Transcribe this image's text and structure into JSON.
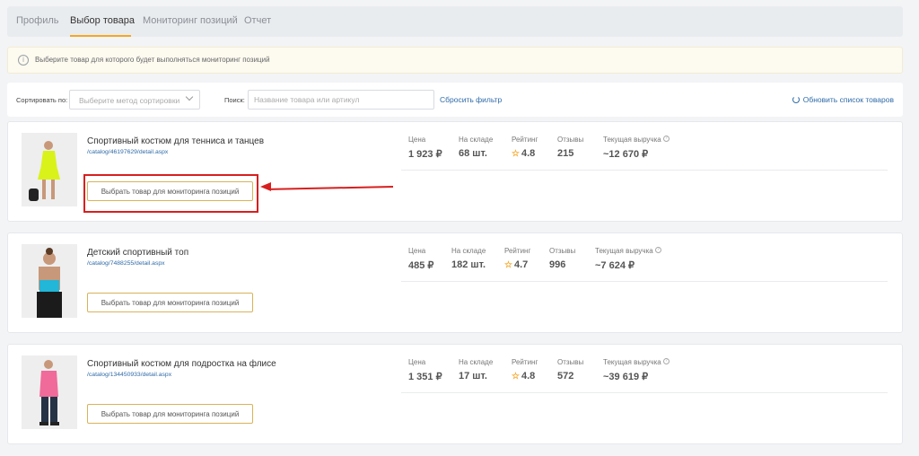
{
  "tabs": [
    {
      "label": "Профиль",
      "active": false
    },
    {
      "label": "Выбор товара",
      "active": true
    },
    {
      "label": "Мониторинг позиций",
      "active": false
    },
    {
      "label": "Отчет",
      "active": false
    }
  ],
  "info": {
    "text": "Выберите товар для которого будет выполняться мониторинг позиций",
    "icon": "info-icon"
  },
  "filters": {
    "sort_label": "Сортировать по:",
    "sort_placeholder": "Выберите метод сортировки",
    "search_label": "Поиск:",
    "search_placeholder": "Название товара или артикул",
    "reset_label": "Сбросить фильтр",
    "refresh_label": "Обновить список товаров"
  },
  "stat_labels": {
    "price": "Цена",
    "stock": "На складе",
    "rating": "Рейтинг",
    "reviews": "Отзывы",
    "revenue": "Текущая выручка"
  },
  "products": [
    {
      "name": "Спортивный костюм для тенниса и танцев",
      "link": "/catalog/46197629/detail.aspx",
      "button": "Выбрать товар для мониторинга позиций",
      "price": "1 923 ₽",
      "stock": "68 шт.",
      "rating": "4.8",
      "reviews": "215",
      "revenue": "~12 670 ₽"
    },
    {
      "name": "Детский спортивный топ",
      "link": "/catalog/7488255/detail.aspx",
      "button": "Выбрать товар для мониторинга позиций",
      "price": "485 ₽",
      "stock": "182 шт.",
      "rating": "4.7",
      "reviews": "996",
      "revenue": "~7 624 ₽"
    },
    {
      "name": "Спортивный костюм для подростка на флисе",
      "link": "/catalog/134450933/detail.aspx",
      "button": "Выбрать товар для мониторинга позиций",
      "price": "1 351 ₽",
      "stock": "17 шт.",
      "rating": "4.8",
      "reviews": "572",
      "revenue": "~39 619 ₽"
    }
  ],
  "colors": {
    "accent": "#f5a623",
    "link": "#2f6ba8",
    "annotation": "#d81f1f"
  }
}
